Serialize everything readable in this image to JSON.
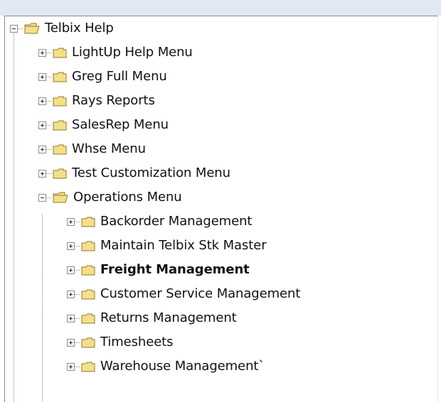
{
  "tree": {
    "root": {
      "label": "Telbix Help",
      "expanded": true
    },
    "items": [
      {
        "label": "LightUp Help Menu",
        "expanded": false
      },
      {
        "label": "Greg Full Menu",
        "expanded": false
      },
      {
        "label": "Rays Reports",
        "expanded": false
      },
      {
        "label": "SalesRep Menu",
        "expanded": false
      },
      {
        "label": "Whse Menu",
        "expanded": false
      },
      {
        "label": "Test Customization Menu",
        "expanded": false
      },
      {
        "label": "Operations Menu",
        "expanded": true,
        "children": [
          {
            "label": "Backorder Management",
            "expanded": false
          },
          {
            "label": "Maintain Telbix Stk Master",
            "expanded": false
          },
          {
            "label": "Freight Management",
            "expanded": false,
            "selected": true
          },
          {
            "label": "Customer Service Management",
            "expanded": false
          },
          {
            "label": "Returns Management",
            "expanded": false
          },
          {
            "label": "Timesheets",
            "expanded": false
          },
          {
            "label": "Warehouse Management`",
            "expanded": false
          }
        ]
      }
    ]
  },
  "colors": {
    "folder_fill": "#f5e089",
    "folder_border": "#8f7a2a",
    "text": "#111111",
    "background": "#ffffff"
  }
}
